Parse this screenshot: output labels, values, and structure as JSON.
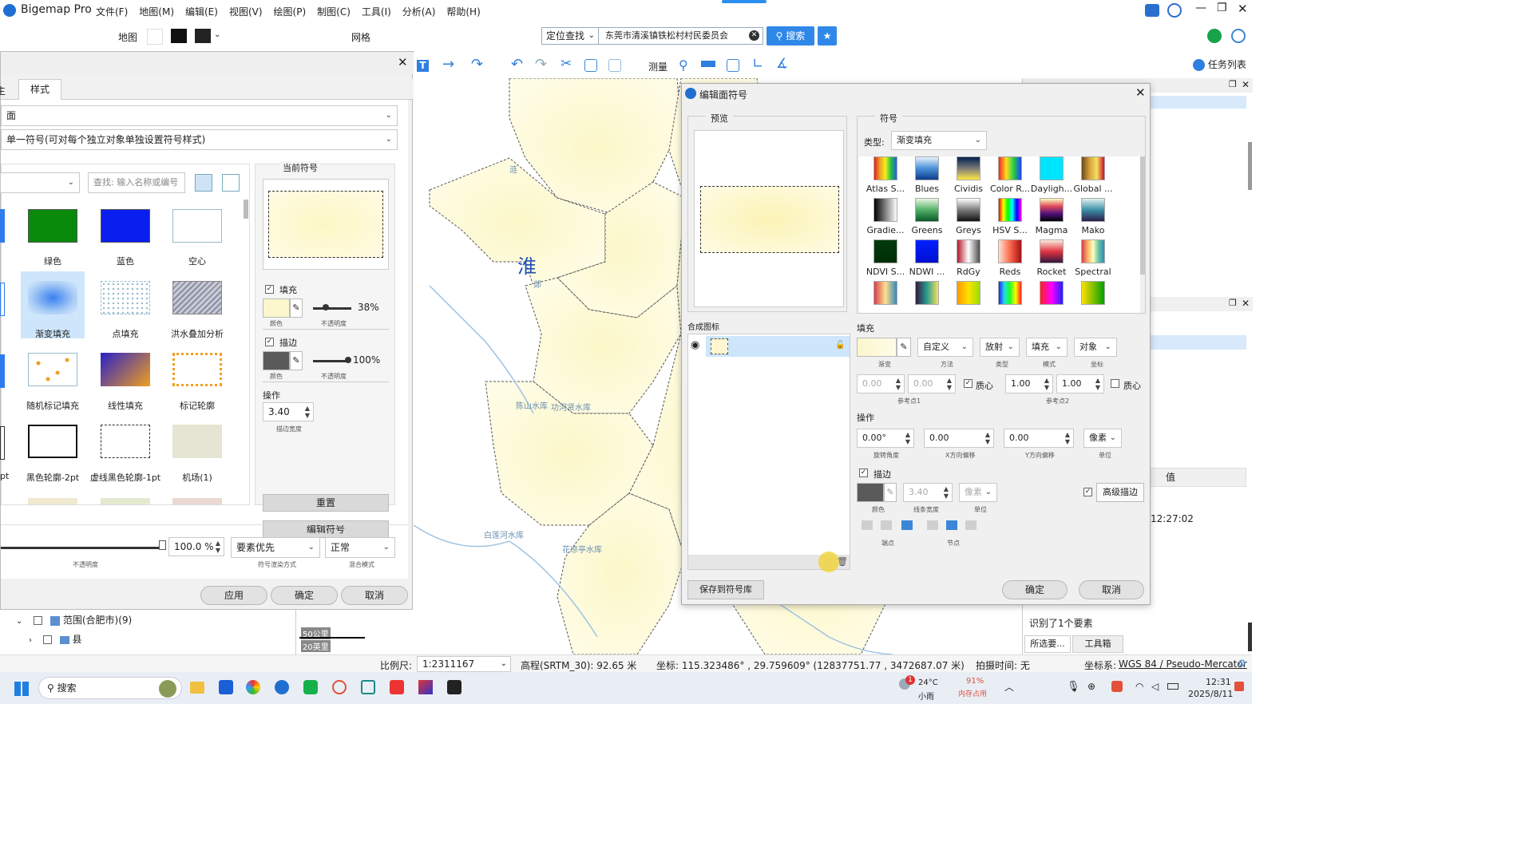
{
  "app": {
    "title": "Bigemap Pro"
  },
  "menu": [
    "文件(F)",
    "地图(M)",
    "编辑(E)",
    "视图(V)",
    "绘图(P)",
    "制图(C)",
    "工具(I)",
    "分析(A)",
    "帮助(H)"
  ],
  "toolbar": {
    "map_label": "地图",
    "grid_label": "网格",
    "locate_label": "定位查找",
    "search_value": "东莞市清溪镇铁松村村民委员会",
    "search_btn": "搜索",
    "measure_label": "测量",
    "task_list": "任务列表"
  },
  "left_dialog": {
    "tab_partial": "主",
    "tab_style": "样式",
    "geometry_select": "面",
    "mode_select": "单一符号(可对每个独立对象单独设置符号样式)",
    "search_placeholder": "查找: 输入名称或编号",
    "symbols": [
      {
        "label": "绿色"
      },
      {
        "label": "蓝色"
      },
      {
        "label": "空心"
      },
      {
        "label": "渐变填充"
      },
      {
        "label": "点填充"
      },
      {
        "label": "洪水叠加分析"
      },
      {
        "label": "随机标记填充"
      },
      {
        "label": "线性填充"
      },
      {
        "label": "标记轮廓"
      },
      {
        "label": "黑色轮廓-2pt"
      },
      {
        "label": "虚线黑色轮廓-1pt"
      },
      {
        "label": "机场(1)"
      }
    ],
    "partial_label": "pt",
    "current_symbol": "当前符号",
    "fill_label": "填充",
    "fill_opacity": "38%",
    "color_caption": "颜色",
    "opacity_caption": "不透明度",
    "stroke_label": "描边",
    "stroke_opacity": "100%",
    "operation_label": "操作",
    "stroke_width": "3.40",
    "stroke_width_caption": "描边宽度",
    "reset_btn": "重置",
    "edit_symbol_btn": "编辑符号",
    "opacity_value": "100.0 %",
    "opacity_bottom_caption": "不透明度",
    "priority_select": "要素优先",
    "render_caption": "符号渲染方式",
    "blend_select": "正常",
    "blend_caption": "混合模式",
    "apply_btn": "应用",
    "ok_btn": "确定",
    "cancel_btn": "取消"
  },
  "layers": [
    {
      "label": "范围(合肥市)(9)"
    },
    {
      "label": "县"
    }
  ],
  "map": {
    "big_label": "淮",
    "labels": [
      "陈山水库",
      "功河贤水库",
      "白莲河水库",
      "花凉亭水库",
      "涟",
      "郯"
    ],
    "scale_a": "50公里",
    "scale_b": "20英里"
  },
  "symbol_dialog": {
    "title": "编辑面符号",
    "preview_label": "预览",
    "symbol_label": "符号",
    "type_label": "类型:",
    "type_value": "渐变填充",
    "gradients": [
      {
        "label": "Atlas S...",
        "css": "linear-gradient(90deg,#e02020,#f0a020,#f0f020,#20c040,#2060e0)"
      },
      {
        "label": "Blues",
        "css": "linear-gradient(180deg,#e6f0fb,#4a90d8,#0c3c8a)"
      },
      {
        "label": "Cividis",
        "css": "linear-gradient(180deg,#00204c,#7c7b78,#ffe945)"
      },
      {
        "label": "Color R...",
        "css": "linear-gradient(90deg,#ff2020,#ffe020,#20d040,#2040ff)"
      },
      {
        "label": "Dayligh...",
        "css": "linear-gradient(180deg,#00e5ff,#00e5ff)"
      },
      {
        "label": "Global ...",
        "css": "linear-gradient(90deg,#6b4a1a,#d4a03a,#f6e060,#c8102e)"
      },
      {
        "label": "Gradie...",
        "css": "linear-gradient(90deg,#000000,#ffffff)"
      },
      {
        "label": "Greens",
        "css": "linear-gradient(180deg,#e9f6e4,#53b067,#0a5a2a)"
      },
      {
        "label": "Greys",
        "css": "linear-gradient(180deg,#ffffff,#7a7a7a,#111111)"
      },
      {
        "label": "HSV S...",
        "css": "linear-gradient(90deg,#ff0000,#ffff00,#00ff00,#00ffff,#0000ff,#ff00ff)"
      },
      {
        "label": "Magma",
        "css": "linear-gradient(180deg,#fcfdbf,#e14b5a,#51127c,#000004)"
      },
      {
        "label": "Mako",
        "css": "linear-gradient(180deg,#dff2ee,#3b8fa8,#2b1d46)"
      },
      {
        "label": "NDVI S...",
        "css": "linear-gradient(180deg,#013a0a,#012e08)"
      },
      {
        "label": "NDWI ...",
        "css": "linear-gradient(180deg,#0020ff,#0010d0)"
      },
      {
        "label": "RdGy",
        "css": "linear-gradient(90deg,#b2182b,#ffffff,#4d4d4d)"
      },
      {
        "label": "Reds",
        "css": "linear-gradient(90deg,#fee0d2,#fb6a4a,#a50f15)"
      },
      {
        "label": "Rocket",
        "css": "linear-gradient(180deg,#faebdd,#e13342,#35193e)"
      },
      {
        "label": "Spectral",
        "css": "linear-gradient(90deg,#d53e4f,#fdae61,#ffffbf,#66c2a5,#3288bd)"
      },
      {
        "label": "",
        "css": "linear-gradient(90deg,#d53e4f,#fee08b,#3288bd)"
      },
      {
        "label": "",
        "css": "linear-gradient(90deg,#35193e,#2a9d8f,#f6e05e)"
      },
      {
        "label": "",
        "css": "linear-gradient(90deg,#ff9900,#ffe000,#99e000)"
      },
      {
        "label": "",
        "css": "linear-gradient(90deg,#2020ff,#20e0e0,#20ff20,#ffff00,#ff2020)"
      },
      {
        "label": "",
        "css": "linear-gradient(90deg,#ff2020,#ff00ff,#2020ff)"
      },
      {
        "label": "",
        "css": "linear-gradient(90deg,#ffe000,#80c000,#00a000)"
      }
    ],
    "composite_label": "合成图标",
    "fill_section": "填充",
    "method_value": "自定义",
    "method_caption": "方法",
    "grad_caption": "渐变",
    "radial_value": "放射",
    "radial_caption": "类型",
    "fillmode_value": "填充",
    "fillmode_caption": "模式",
    "object_value": "对象",
    "object_caption": "坐标",
    "p1x": "0.00",
    "p1y": "0.00",
    "centroid": "质心",
    "p1_caption": "参考点1",
    "p2x": "1.00",
    "p2y": "1.00",
    "p2_caption": "参考点2",
    "op_section": "操作",
    "rotation": "0.00°",
    "rotation_caption": "旋转角度",
    "xoff": "0.00",
    "xoff_caption": "X方向偏移",
    "yoff": "0.00",
    "yoff_caption": "Y方向偏移",
    "unit_value": "像素",
    "unit_caption": "单位",
    "stroke_section": "描边",
    "stroke_width": "3.40",
    "stroke_width_caption": "线条宽度",
    "stroke_unit": "像素",
    "color_caption": "颜色",
    "advanced_btn": "高级描边",
    "cap_caption": "端点",
    "join_caption": "节点",
    "save_btn": "保存到符号库",
    "ok_btn": "确定",
    "cancel_btn": "取消"
  },
  "right_panel": {
    "col_value": "值",
    "time_value": "12:27:02",
    "identified": "识别了1个要素",
    "selected_tab": "所选要...",
    "toolbox_tab": "工具箱"
  },
  "status": {
    "scale_label": "比例尺:",
    "scale_value": "1:2311167",
    "elevation": "高程(SRTM_30): 92.65 米",
    "coords": "坐标: 115.323486° , 29.759609°  (12837751.77 , 3472687.07 米)",
    "shoot_time": "拍摄时间: 无",
    "crs_label": "坐标系:",
    "crs_value": "WGS 84 / Pseudo-Mercator"
  },
  "taskbar": {
    "search": "搜索",
    "weather_temp": "24°C",
    "weather_desc": "小雨",
    "mem": "91%",
    "mem_caption": "内存占用",
    "time": "12:31",
    "date": "2025/8/11",
    "badge": "1"
  }
}
